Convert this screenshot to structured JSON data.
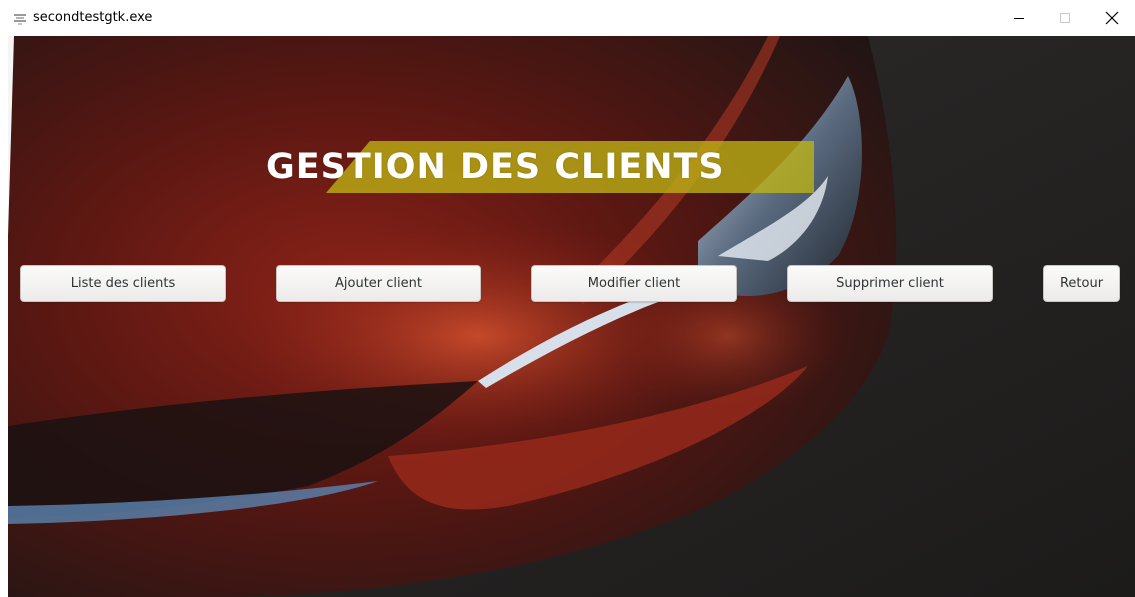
{
  "window": {
    "title": "secondtestgtk.exe",
    "icons": [
      "app-icon",
      "minimize-icon",
      "maximize-icon",
      "close-icon"
    ]
  },
  "main": {
    "heading": "GESTION DES CLIENTS",
    "accent_color": "#c2b714",
    "buttons": [
      {
        "label": "Liste des clients"
      },
      {
        "label": "Ajouter client"
      },
      {
        "label": "Modifier client"
      },
      {
        "label": "Supprimer client"
      },
      {
        "label": "Retour"
      }
    ]
  }
}
